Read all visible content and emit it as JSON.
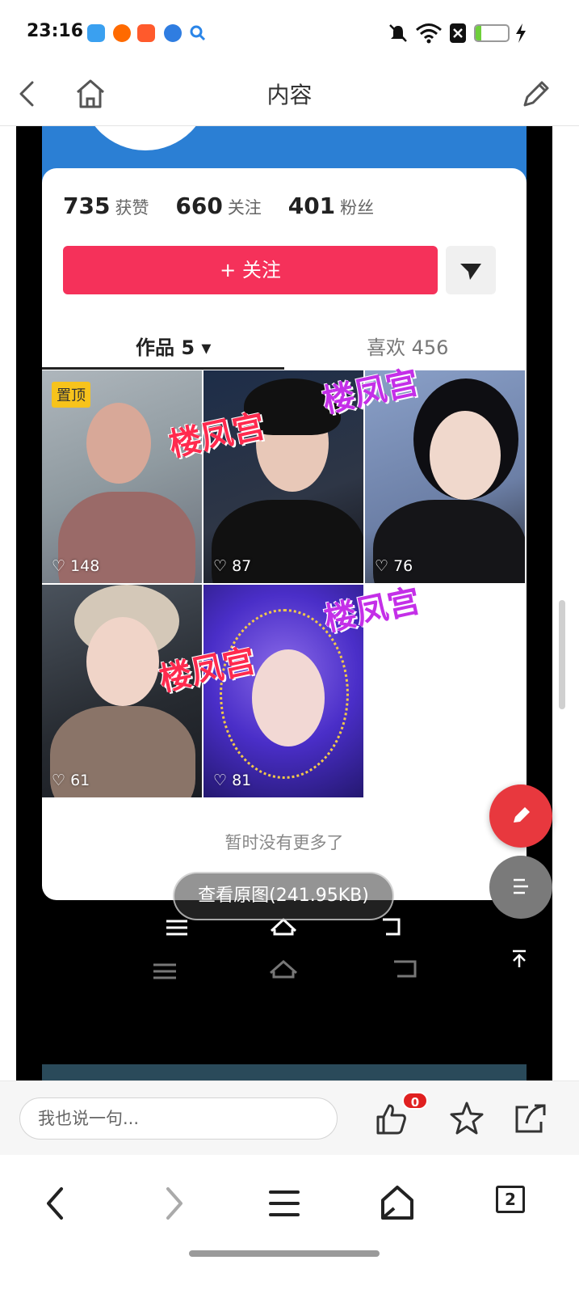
{
  "status_bar": {
    "time": "23:16",
    "battery_level": "17",
    "battery_fraction": 0.17,
    "notification_icons": [
      "qq-browser-icon",
      "taobao-icon",
      "app-store-icon",
      "messenger-icon",
      "search-icon"
    ]
  },
  "header": {
    "title": "内容"
  },
  "profile": {
    "likes_count": "735",
    "likes_label": "获赞",
    "following_count": "660",
    "following_label": "关注",
    "followers_count": "401",
    "followers_label": "粉丝",
    "follow_button": "+ 关注",
    "tab_works": "作品 5 ▾",
    "tab_liked": "喜欢 456",
    "pinned_label": "置顶",
    "videos": [
      {
        "likes": "148"
      },
      {
        "likes": "87"
      },
      {
        "likes": "76"
      },
      {
        "likes": "61"
      },
      {
        "likes": "81"
      }
    ],
    "no_more_text": "暂时没有更多了",
    "watermark_text": "楼凤宫"
  },
  "image_viewer": {
    "view_original": "查看原图(241.95KB)"
  },
  "comment_bar": {
    "placeholder": "我也说一句...",
    "like_badge": "0"
  },
  "browser_nav": {
    "tab_count": "2"
  },
  "colors": {
    "follow_red": "#f5315a",
    "fab_red": "#e8383e",
    "badge_red": "#e02020",
    "pin_yellow": "#f7c31c",
    "profile_blue": "#2b7fd4"
  }
}
